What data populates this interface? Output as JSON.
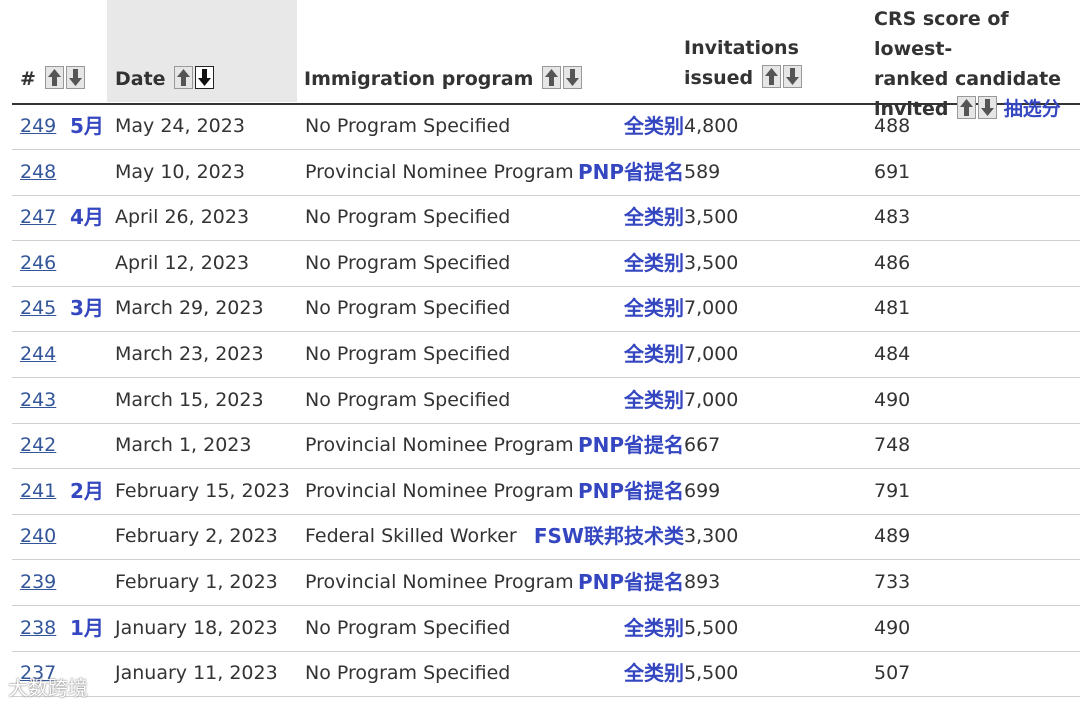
{
  "header": {
    "num_label": "#",
    "date_label": "Date",
    "program_label": "Immigration program",
    "invitations_line1": "Invitations",
    "invitations_line2": "issued",
    "crs_line1": "CRS score of lowest-",
    "crs_line2": "ranked candidate",
    "crs_line3": "invited",
    "crs_annotation": "抽选分"
  },
  "icons": {
    "sort_up": "arrow-up-icon",
    "sort_down": "arrow-down-icon"
  },
  "colors": {
    "annotation": "#3547c0",
    "link": "#335599",
    "header_highlight": "#e8e8e8"
  },
  "rows": [
    {
      "num": "249",
      "month": "5月",
      "date": "May 24, 2023",
      "program": "No Program Specified",
      "category": "全类别",
      "invitations": "4,800",
      "crs": "488"
    },
    {
      "num": "248",
      "month": "",
      "date": "May 10, 2023",
      "program": "Provincial Nominee Program",
      "category": "PNP省提名",
      "invitations": "589",
      "crs": "691"
    },
    {
      "num": "247",
      "month": "4月",
      "date": "April 26, 2023",
      "program": "No Program Specified",
      "category": "全类别",
      "invitations": "3,500",
      "crs": "483"
    },
    {
      "num": "246",
      "month": "",
      "date": "April 12, 2023",
      "program": "No Program Specified",
      "category": "全类别",
      "invitations": "3,500",
      "crs": "486"
    },
    {
      "num": "245",
      "month": "3月",
      "date": "March 29, 2023",
      "program": "No Program Specified",
      "category": "全类别",
      "invitations": "7,000",
      "crs": "481"
    },
    {
      "num": "244",
      "month": "",
      "date": "March 23, 2023",
      "program": "No Program Specified",
      "category": "全类别",
      "invitations": "7,000",
      "crs": "484"
    },
    {
      "num": "243",
      "month": "",
      "date": "March 15, 2023",
      "program": "No Program Specified",
      "category": "全类别",
      "invitations": "7,000",
      "crs": "490"
    },
    {
      "num": "242",
      "month": "",
      "date": "March 1, 2023",
      "program": "Provincial Nominee Program",
      "category": "PNP省提名",
      "invitations": "667",
      "crs": "748"
    },
    {
      "num": "241",
      "month": "2月",
      "date": "February 15, 2023",
      "program": "Provincial Nominee Program",
      "category": "PNP省提名",
      "invitations": "699",
      "crs": "791"
    },
    {
      "num": "240",
      "month": "",
      "date": "February 2, 2023",
      "program": "Federal Skilled Worker",
      "category": "FSW联邦技术类",
      "invitations": "3,300",
      "crs": "489"
    },
    {
      "num": "239",
      "month": "",
      "date": "February 1, 2023",
      "program": "Provincial Nominee Program",
      "category": "PNP省提名",
      "invitations": "893",
      "crs": "733"
    },
    {
      "num": "238",
      "month": "1月",
      "date": "January 18, 2023",
      "program": "No Program Specified",
      "category": "全类别",
      "invitations": "5,500",
      "crs": "490"
    },
    {
      "num": "237",
      "month": "",
      "date": "January 11, 2023",
      "program": "No Program Specified",
      "category": "全类别",
      "invitations": "5,500",
      "crs": "507"
    }
  ],
  "watermark": "大数跨境"
}
